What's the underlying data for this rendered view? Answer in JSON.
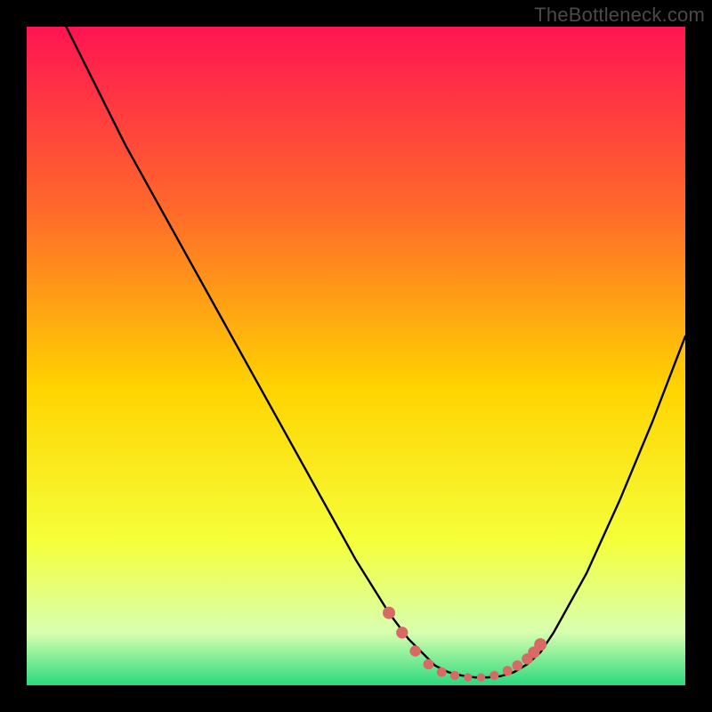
{
  "watermark": "TheBottleneck.com",
  "colors": {
    "gradient_top": "#ff1452",
    "gradient_upper_mid": "#ff6a2a",
    "gradient_mid": "#ffd400",
    "gradient_lower_mid": "#f5ff3a",
    "gradient_near_bottom": "#d8ffb0",
    "gradient_bottom": "#2bd97c",
    "curve": "#000000",
    "marker": "#d86a66",
    "background": "#000000"
  },
  "chart_data": {
    "type": "line",
    "title": "",
    "xlabel": "",
    "ylabel": "",
    "xlim": [
      0,
      100
    ],
    "ylim": [
      0,
      100
    ],
    "series": [
      {
        "name": "bottleneck-curve",
        "x": [
          6,
          10,
          15,
          20,
          25,
          30,
          35,
          40,
          45,
          50,
          55,
          58,
          60,
          62,
          64,
          66,
          68,
          70,
          72,
          74,
          76,
          78,
          80,
          85,
          90,
          95,
          100
        ],
        "y": [
          100,
          92,
          82,
          73,
          64,
          55,
          46,
          37,
          28,
          19,
          11,
          7,
          5,
          3,
          2,
          1.5,
          1.2,
          1.2,
          1.4,
          2,
          3.2,
          5,
          8,
          17,
          28,
          40,
          53
        ]
      }
    ],
    "markers": {
      "name": "highlight-dots",
      "points": [
        {
          "x": 55,
          "y": 11
        },
        {
          "x": 57,
          "y": 8
        },
        {
          "x": 59,
          "y": 5.2
        },
        {
          "x": 61,
          "y": 3.2
        },
        {
          "x": 63,
          "y": 2.0
        },
        {
          "x": 65,
          "y": 1.5
        },
        {
          "x": 67,
          "y": 1.2
        },
        {
          "x": 69,
          "y": 1.2
        },
        {
          "x": 71,
          "y": 1.5
        },
        {
          "x": 73,
          "y": 2.2
        },
        {
          "x": 74.5,
          "y": 3.0
        },
        {
          "x": 76,
          "y": 4.0
        },
        {
          "x": 77,
          "y": 5.0
        },
        {
          "x": 78,
          "y": 6.2
        }
      ]
    }
  }
}
